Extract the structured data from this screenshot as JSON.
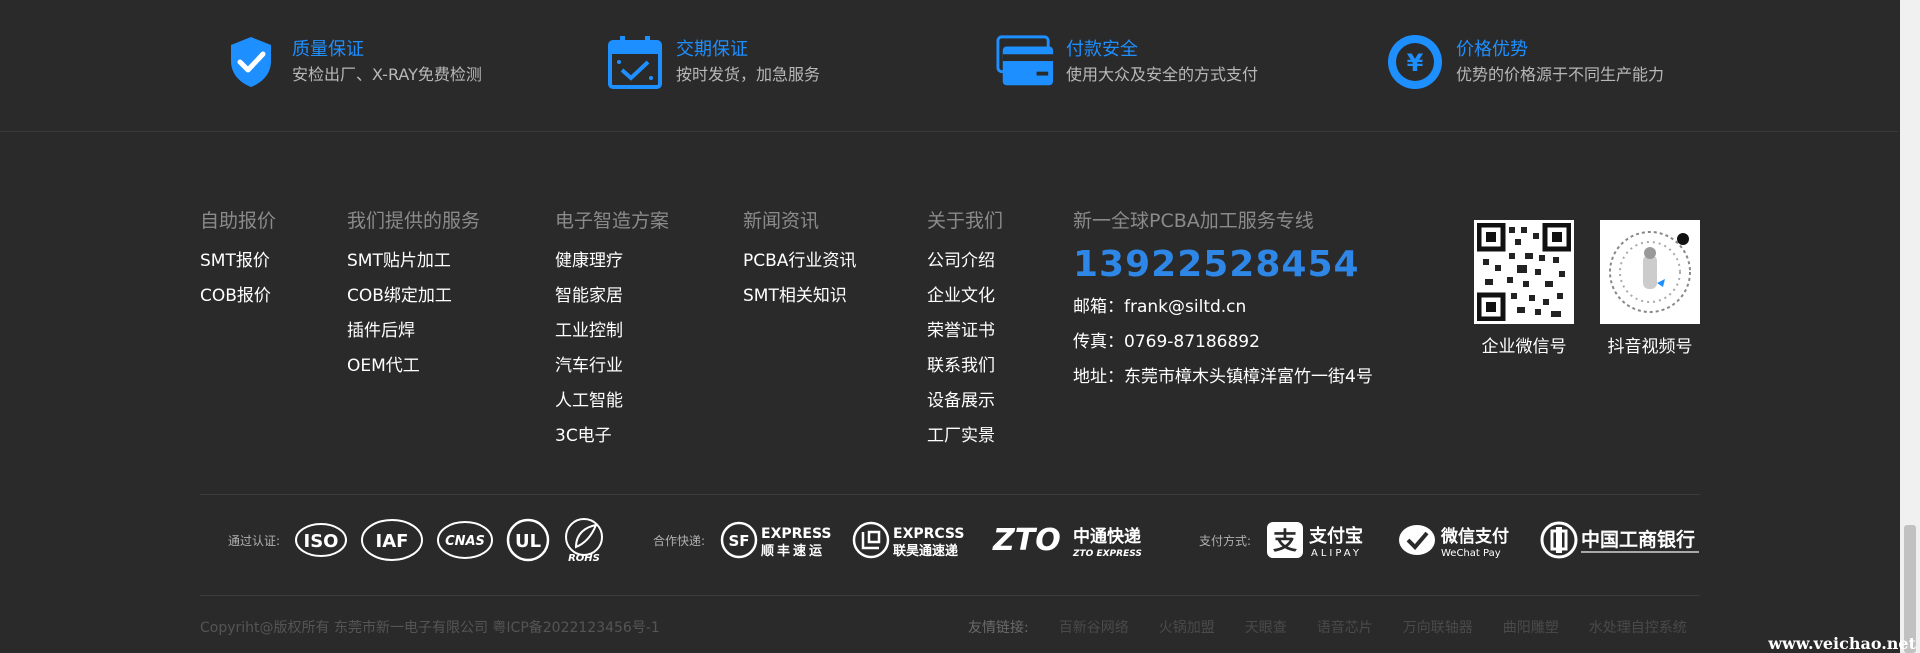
{
  "guarantees": [
    {
      "icon": "shield-check-icon",
      "title": "质量保证",
      "sub": "安检出厂、X-RAY免费检测"
    },
    {
      "icon": "calendar-check-icon",
      "title": "交期保证",
      "sub": "按时发货，加急服务"
    },
    {
      "icon": "credit-card-icon",
      "title": "付款安全",
      "sub": "使用大众及安全的方式支付"
    },
    {
      "icon": "yen-coin-icon",
      "title": "价格优势",
      "sub": "优势的价格源于不同生产能力"
    }
  ],
  "columns": [
    {
      "heading": "自助报价",
      "links": [
        "SMT报价",
        "COB报价"
      ]
    },
    {
      "heading": "我们提供的服务",
      "links": [
        "SMT贴片加工",
        "COB绑定加工",
        "插件后焊",
        "OEM代工"
      ]
    },
    {
      "heading": "电子智造方案",
      "links": [
        "健康理疗",
        "智能家居",
        "工业控制",
        "汽车行业",
        "人工智能",
        "3C电子"
      ]
    },
    {
      "heading": "新闻资讯",
      "links": [
        "PCBA行业资讯",
        "SMT相关知识"
      ]
    },
    {
      "heading": "关于我们",
      "links": [
        "公司介绍",
        "企业文化",
        "荣誉证书",
        "联系我们",
        "设备展示",
        "工厂实景"
      ]
    }
  ],
  "contact": {
    "heading": "新一全球PCBA加工服务专线",
    "phone": "13922528454",
    "email": "邮箱：frank@siltd.cn",
    "fax": "传真：0769-87186892",
    "address": "地址：东莞市樟木头镇樟洋富竹一街4号"
  },
  "qr": {
    "wechat_label": "企业微信号",
    "douyin_label": "抖音视频号"
  },
  "logos": {
    "cert_label": "通过认证:",
    "express_label": "合作快递:",
    "pay_label": "支付方式:",
    "iso": "ISO",
    "iaf": "IAF",
    "cnas": "CNAS",
    "ul": "UL",
    "rohs": "ROHS",
    "sf_top": "EXPRESS",
    "sf_bottom": "顺丰速运",
    "lianhao_top": "EXPRCSS",
    "lianhao_bottom": "联昊通速递",
    "zto_main": "ZTO",
    "zto_cn": "中通快递",
    "zto_sub": "ZTO EXPRESS",
    "alipay_cn": "支付宝",
    "alipay_en": "ALIPAY",
    "wechat_cn": "微信支付",
    "wechat_en": "WeChat Pay",
    "icbc_cn": "中国工商银行"
  },
  "copyright": "Copyriht@版权所有 东莞市新一电子有限公司 粤ICP备2022123456号-1",
  "friend_links": {
    "label": "友情链接:",
    "links": [
      "百新谷网络",
      "火锅加盟",
      "天眼查",
      "语音芯片",
      "万向联轴器",
      "曲阳雕塑",
      "水处理自控系统"
    ]
  },
  "watermark": "www.veichao.net",
  "colors": {
    "accent": "#1e8fff",
    "phone": "#2e86e6",
    "background": "#2a2a2a"
  }
}
